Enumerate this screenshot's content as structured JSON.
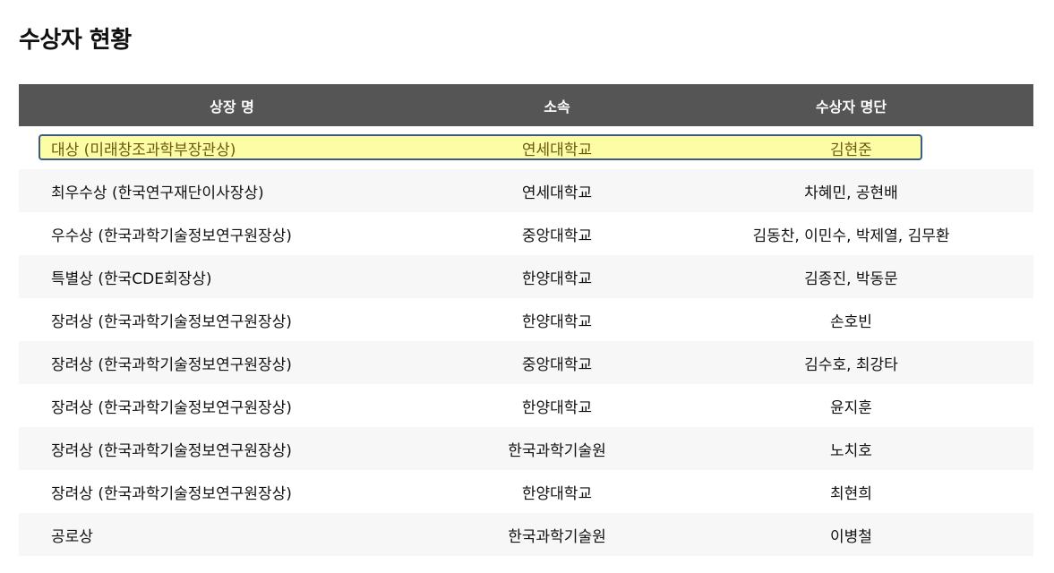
{
  "page": {
    "title": "수상자 현황"
  },
  "table": {
    "headers": {
      "award": "상장 명",
      "affiliation": "소속",
      "recipients": "수상자 명단"
    },
    "rows": [
      {
        "award": "대상 (미래창조과학부장관상)",
        "affiliation": "연세대학교",
        "recipients": "김현준"
      },
      {
        "award": "최우수상 (한국연구재단이사장상)",
        "affiliation": "연세대학교",
        "recipients": "차혜민, 공현배"
      },
      {
        "award": "우수상 (한국과학기술정보연구원장상)",
        "affiliation": "중앙대학교",
        "recipients": "김동찬, 이민수, 박제열, 김무환"
      },
      {
        "award": "특별상 (한국CDE회장상)",
        "affiliation": "한양대학교",
        "recipients": "김종진, 박동문"
      },
      {
        "award": "장려상 (한국과학기술정보연구원장상)",
        "affiliation": "한양대학교",
        "recipients": "손호빈"
      },
      {
        "award": "장려상 (한국과학기술정보연구원장상)",
        "affiliation": "중앙대학교",
        "recipients": "김수호, 최강타"
      },
      {
        "award": "장려상 (한국과학기술정보연구원장상)",
        "affiliation": "한양대학교",
        "recipients": "윤지훈"
      },
      {
        "award": "장려상 (한국과학기술정보연구원장상)",
        "affiliation": "한국과학기술원",
        "recipients": "노치호"
      },
      {
        "award": "장려상 (한국과학기술정보연구원장상)",
        "affiliation": "한양대학교",
        "recipients": "최현희"
      },
      {
        "award": "공로상",
        "affiliation": "한국과학기술원",
        "recipients": "이병철"
      }
    ]
  },
  "colors": {
    "header_bg": "#555555",
    "highlight_fill": "#fdfda5",
    "highlight_border": "#3c5a86",
    "alt_row_bg": "#f7f7f7"
  }
}
